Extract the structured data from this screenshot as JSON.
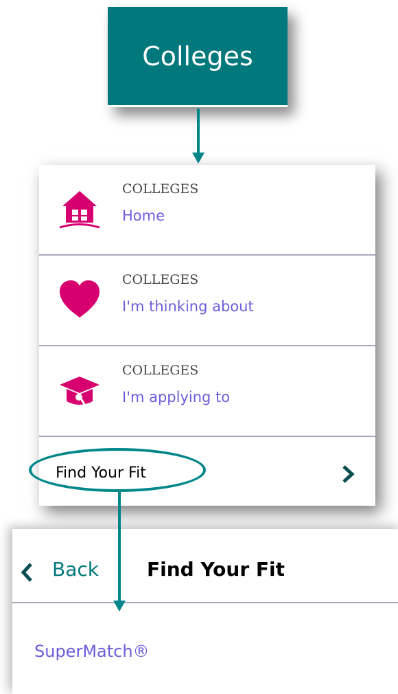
{
  "top_button": {
    "label": "Colleges"
  },
  "menu": {
    "items": [
      {
        "kicker": "COLLEGES",
        "link": "Home",
        "icon": "house-icon"
      },
      {
        "kicker": "COLLEGES",
        "link": "I'm thinking about",
        "icon": "heart-icon"
      },
      {
        "kicker": "COLLEGES",
        "link": "I'm applying to",
        "icon": "graduation-cap-icon"
      }
    ],
    "find_fit": {
      "label": "Find Your Fit",
      "icon": "chevron-right-icon"
    }
  },
  "submenu": {
    "back_label": "Back",
    "title": "Find Your Fit",
    "item": "SuperMatch®"
  },
  "colors": {
    "teal": "#00787c",
    "accent_pink": "#d6006e",
    "link_purple": "#6b5ddb",
    "divider": "#a9a7bd"
  }
}
